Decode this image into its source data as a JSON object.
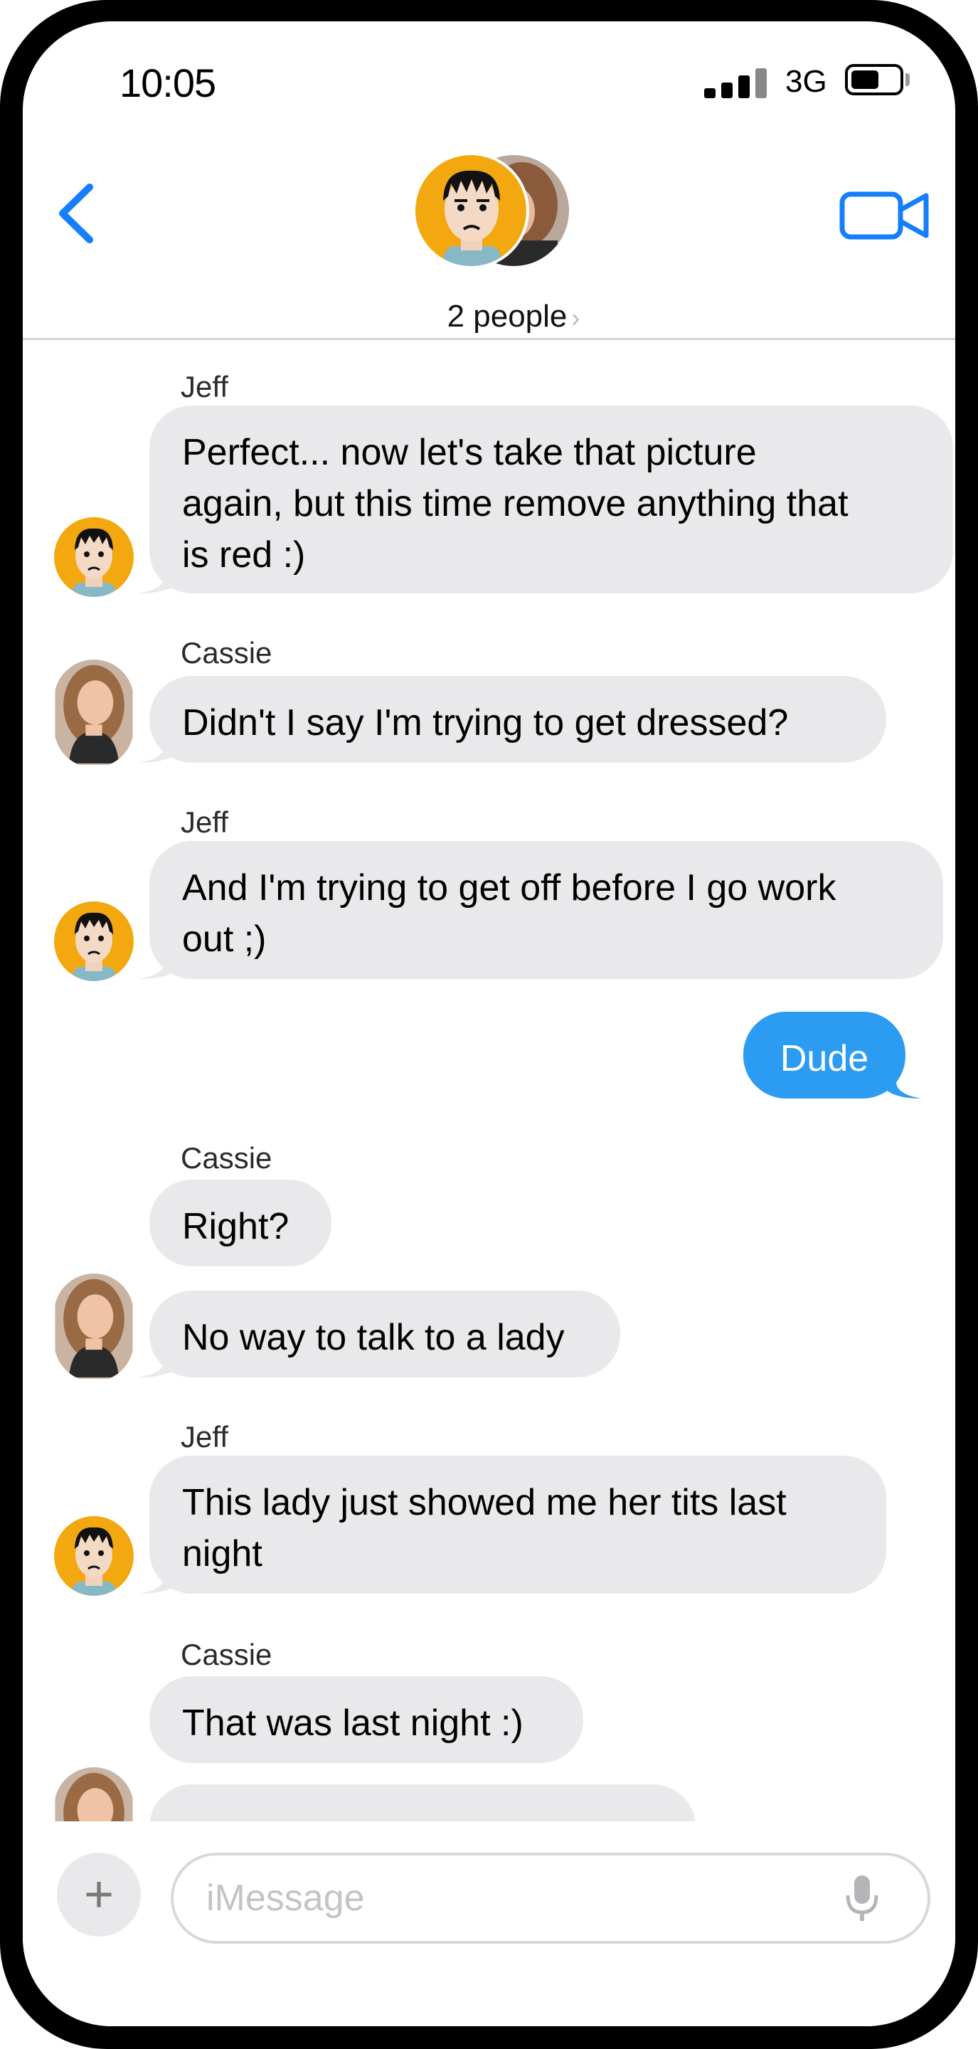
{
  "status_bar": {
    "time": "10:05",
    "network": "3G",
    "signal_icon": "cellular-signal-icon",
    "battery_icon": "battery-icon"
  },
  "header": {
    "back_icon": "chevron-left-icon",
    "video_icon": "video-camera-icon",
    "people_label": "2 people",
    "people_chevron": "›"
  },
  "conversation": [
    {
      "sender": "Jeff",
      "type": "received",
      "lines": [
        "Perfect... now let's take that picture",
        "again, but this time remove anything that",
        "is red :)"
      ]
    },
    {
      "sender": "Cassie",
      "type": "received",
      "lines": [
        "Didn't I say I'm trying to get dressed?"
      ]
    },
    {
      "sender": "Jeff",
      "type": "received",
      "lines": [
        "And I'm trying to get off before I go work",
        "out ;)"
      ]
    },
    {
      "sender": "",
      "type": "sent",
      "lines": [
        "Dude"
      ]
    },
    {
      "sender": "Cassie",
      "type": "received",
      "lines": [
        "Right?"
      ]
    },
    {
      "sender": "",
      "type": "received",
      "lines": [
        "No way to talk to a lady"
      ]
    },
    {
      "sender": "Jeff",
      "type": "received",
      "lines": [
        "This lady just showed me her tits last",
        "night"
      ]
    },
    {
      "sender": "Cassie",
      "type": "received",
      "lines": [
        "That was last night :)"
      ]
    }
  ],
  "composer": {
    "placeholder": "iMessage",
    "plus_label": "+",
    "mic_icon": "microphone-icon"
  },
  "colors": {
    "accent": "#147efb",
    "sent_bubble": "#2b9cf2",
    "received_bubble": "#e9e9eb",
    "jeff_avatar_bg": "#f3a80f"
  }
}
